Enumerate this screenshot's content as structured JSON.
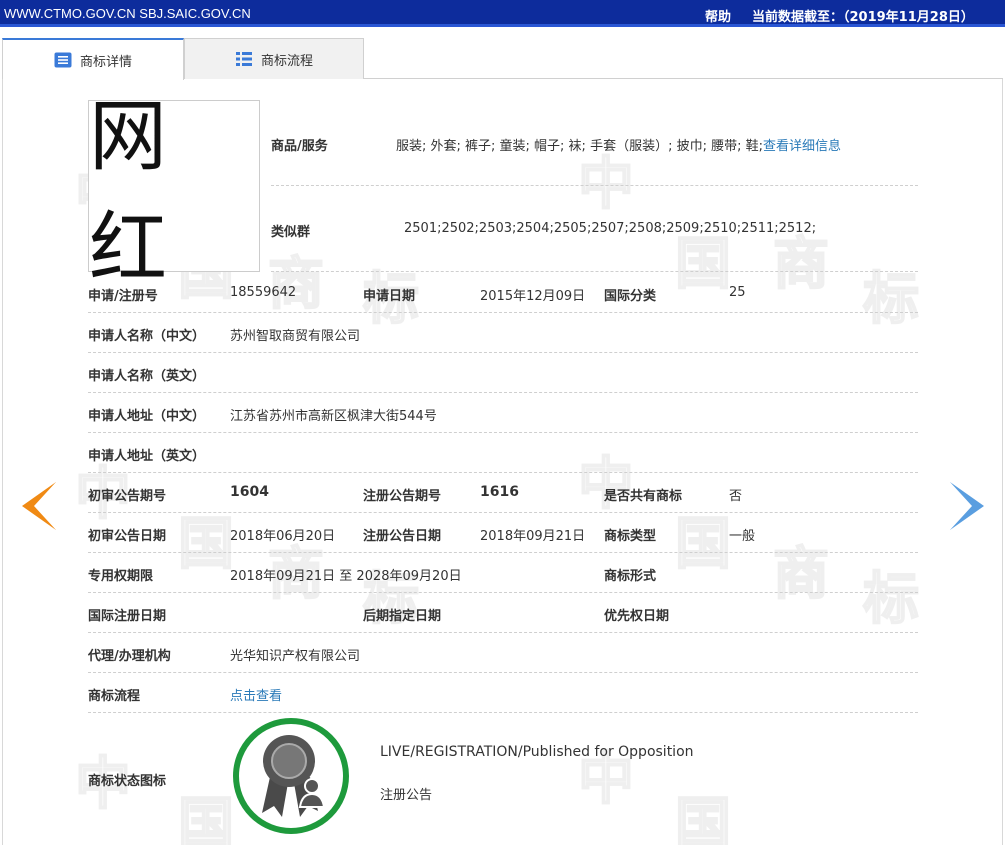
{
  "topbar": {
    "url": "WWW.CTMO.GOV.CN SBJ.SAIC.GOV.CN",
    "help": "帮助",
    "data_date": "当前数据截至：（2019年11月28日）"
  },
  "tabs": [
    {
      "label": "商标详情",
      "icon": "list-detail-icon",
      "active": true
    },
    {
      "label": "商标流程",
      "icon": "list-flow-icon",
      "active": false
    }
  ],
  "watermark": {
    "chars": [
      "中",
      "国",
      "商",
      "标"
    ]
  },
  "trademark": {
    "image_text": "网 红"
  },
  "goods": {
    "label": "商品/服务",
    "value": "服装; 外套; 裤子; 童装; 帽子; 袜; 手套（服装）; 披巾; 腰带; 鞋;",
    "link": "查看详细信息"
  },
  "similar": {
    "label": "类似群",
    "value": "2501;2502;2503;2504;2505;2507;2508;2509;2510;2511;2512;"
  },
  "rows": {
    "reg_no": {
      "label": "申请/注册号",
      "value": "18559642"
    },
    "apply_date": {
      "label": "申请日期",
      "value": "2015年12月09日"
    },
    "intl_class": {
      "label": "国际分类",
      "value": "25"
    },
    "applicant_cn": {
      "label": "申请人名称（中文）",
      "value": "苏州智取商贸有限公司"
    },
    "applicant_en": {
      "label": "申请人名称（英文）",
      "value": ""
    },
    "address_cn": {
      "label": "申请人地址（中文）",
      "value": "江苏省苏州市高新区枫津大街544号"
    },
    "address_en": {
      "label": "申请人地址（英文）",
      "value": ""
    },
    "prelim_pub_no": {
      "label": "初审公告期号",
      "value": "1604"
    },
    "reg_pub_no": {
      "label": "注册公告期号",
      "value": "1616"
    },
    "shared": {
      "label": "是否共有商标",
      "value": "否"
    },
    "prelim_pub_date": {
      "label": "初审公告日期",
      "value": "2018年06月20日"
    },
    "reg_pub_date": {
      "label": "注册公告日期",
      "value": "2018年09月21日"
    },
    "tm_type": {
      "label": "商标类型",
      "value": "一般"
    },
    "exclusive_period": {
      "label": "专用权期限",
      "value": "2018年09月21日 至 2028年09月20日"
    },
    "tm_form": {
      "label": "商标形式",
      "value": ""
    },
    "intl_reg_date": {
      "label": "国际注册日期",
      "value": ""
    },
    "later_designation": {
      "label": "后期指定日期",
      "value": ""
    },
    "priority_date": {
      "label": "优先权日期",
      "value": ""
    },
    "agent": {
      "label": "代理/办理机构",
      "value": "光华知识产权有限公司"
    },
    "flow": {
      "label": "商标流程",
      "link": "点击查看"
    },
    "status_icon": {
      "label": "商标状态图标"
    }
  },
  "status": {
    "en": "LIVE/REGISTRATION/Published for Opposition",
    "cn": "注册公告",
    "badge_icon": "registration-medal-icon",
    "ring_color": "#1e9a3c"
  },
  "nav": {
    "prev_icon": "arrow-left-icon",
    "next_icon": "arrow-right-icon",
    "prev_color": "#f08a14",
    "next_color": "#5a9ee0"
  },
  "colors": {
    "topbar": "#0d2c9c",
    "link": "#2a7ab8"
  }
}
